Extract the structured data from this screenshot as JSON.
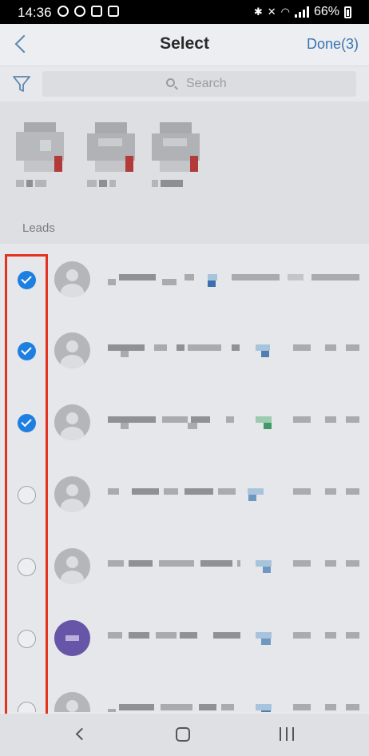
{
  "status_bar": {
    "time": "14:36",
    "battery": "66%"
  },
  "nav": {
    "title": "Select",
    "done_label": "Done(3)"
  },
  "search": {
    "placeholder": "Search"
  },
  "section": {
    "leads_label": "Leads"
  },
  "selected_count": 3,
  "icons": {
    "back": "chevron-left-icon",
    "filter": "filter-funnel-icon",
    "search": "search-icon"
  },
  "colors": {
    "accent": "#1e7fe0",
    "highlight": "#e3321f",
    "link": "#3a74b0"
  },
  "leads": [
    {
      "checked": true,
      "avatar": "default"
    },
    {
      "checked": true,
      "avatar": "default"
    },
    {
      "checked": true,
      "avatar": "default"
    },
    {
      "checked": false,
      "avatar": "default"
    },
    {
      "checked": false,
      "avatar": "default"
    },
    {
      "checked": false,
      "avatar": "initials-purple"
    },
    {
      "checked": false,
      "avatar": "default"
    }
  ]
}
